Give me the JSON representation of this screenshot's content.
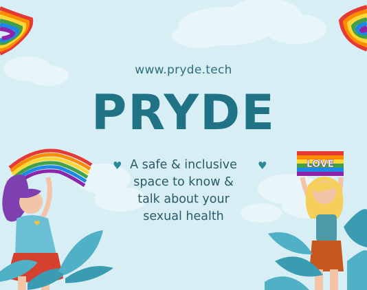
{
  "website_url": "www.pryde.tech",
  "brand_name": "PRYDE",
  "tagline_lines": [
    "A safe & inclusive",
    "space to know &",
    "talk about your",
    "sexual health"
  ],
  "flag_text": "LOVE",
  "icons": [
    "heart-icon",
    "heart-icon"
  ],
  "colors": {
    "background": "#d8eef5",
    "title": "#1f7384",
    "text": "#2a5a66",
    "heart": "#2a8a9a",
    "leaf": "#4fb0c6"
  }
}
